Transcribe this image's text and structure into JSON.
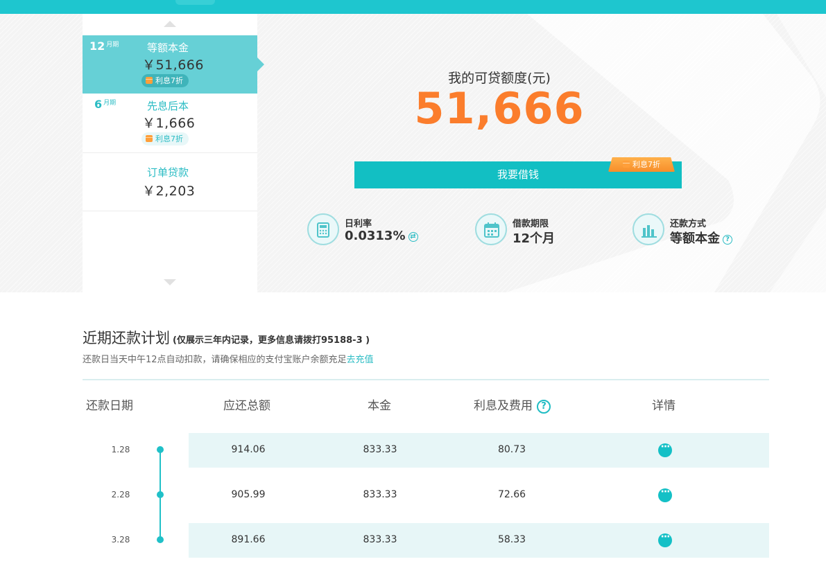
{
  "plans": [
    {
      "term": "12",
      "term_unit": "月期",
      "name": "等额本金",
      "amount": "￥51,666",
      "badge": "利息7折"
    },
    {
      "term": "6",
      "term_unit": "月期",
      "name": "先息后本",
      "amount": "￥1,666",
      "badge": "利息7折"
    },
    {
      "name": "订单贷款",
      "amount": "￥2,203"
    }
  ],
  "credit": {
    "title": "我的可贷额度(元)",
    "amount": "51,666",
    "borrow_label": "我要借钱",
    "borrow_badge": "利息7折"
  },
  "stats": {
    "rate_label": "日利率",
    "rate_value": "0.0313%",
    "term_label": "借款期限",
    "term_value": "12个月",
    "method_label": "还款方式",
    "method_value": "等额本金"
  },
  "schedule": {
    "title": "近期还款计划",
    "note": "(仅展示三年内记录，更多信息请拨打95188-3 )",
    "tip": "还款日当天中午12点自动扣款，请确保相应的支付宝账户余额充足",
    "tip_link": "去充值",
    "headers": {
      "date": "还款日期",
      "total": "应还总额",
      "principal": "本金",
      "interest": "利息及费用",
      "detail": "详情"
    },
    "rows": [
      {
        "date": "1.28",
        "total": "914.06",
        "principal": "833.33",
        "interest": "80.73"
      },
      {
        "date": "2.28",
        "total": "905.99",
        "principal": "833.33",
        "interest": "72.66"
      },
      {
        "date": "3.28",
        "total": "891.66",
        "principal": "833.33",
        "interest": "58.33"
      }
    ]
  },
  "colors": {
    "brand": "#1ec6cf",
    "accent_orange": "#fb7d2c",
    "button": "#12bfc3"
  }
}
